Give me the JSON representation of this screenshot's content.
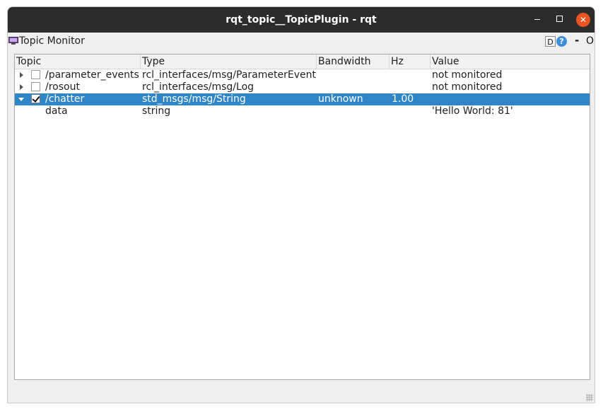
{
  "window": {
    "title": "rqt_topic__TopicPlugin - rqt",
    "close_glyph": "✕"
  },
  "plugin": {
    "title": "Topic Monitor",
    "icon": "monitor-icon",
    "d_label": "D",
    "help_label": "?",
    "dash_label": "-",
    "o_label": "O"
  },
  "table": {
    "columns": [
      "Topic",
      "Type",
      "Bandwidth",
      "Hz",
      "Value"
    ],
    "rows": [
      {
        "topic": "/parameter_events",
        "type": "rcl_interfaces/msg/ParameterEvent",
        "bandwidth": "",
        "hz": "",
        "value": "not monitored",
        "checked": false,
        "expanded": false,
        "selected": false
      },
      {
        "topic": "/rosout",
        "type": "rcl_interfaces/msg/Log",
        "bandwidth": "",
        "hz": "",
        "value": "not monitored",
        "checked": false,
        "expanded": false,
        "selected": false
      },
      {
        "topic": "/chatter",
        "type": "std_msgs/msg/String",
        "bandwidth": "unknown",
        "hz": "1.00",
        "value": "",
        "checked": true,
        "expanded": true,
        "selected": true
      },
      {
        "topic": "data",
        "type": "string",
        "bandwidth": "",
        "hz": "",
        "value": "'Hello World: 81'",
        "child": true
      }
    ]
  },
  "colors": {
    "titlebar": "#2c2c2c",
    "close_button": "#e95420",
    "selection": "#2f86c6"
  }
}
